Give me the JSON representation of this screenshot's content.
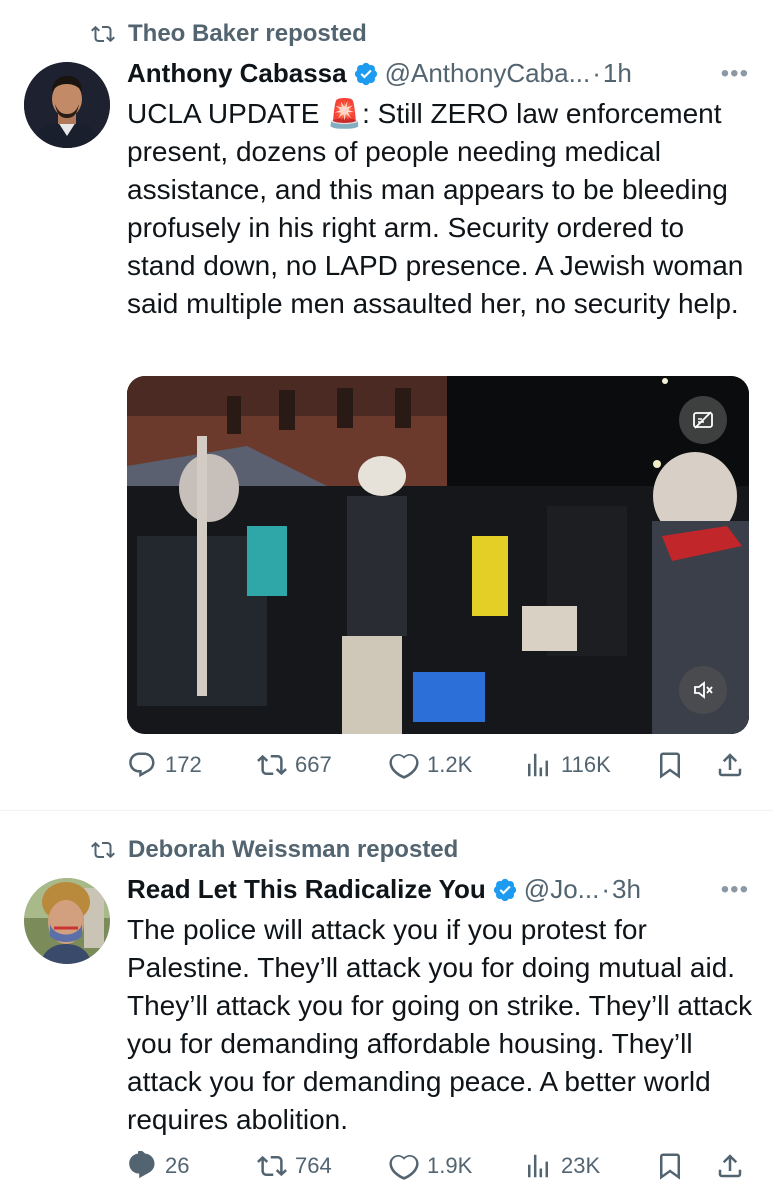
{
  "tweets": [
    {
      "reposted_by": "Theo Baker reposted",
      "name": "Anthony Cabassa",
      "handle": "@AnthonyCaba...",
      "dot": "·",
      "time": "1h",
      "more": "•••",
      "text_prefix": "UCLA UPDATE ",
      "emoji": "🚨",
      "text": ": Still ZERO law enforcement present, dozens of people needing medical assistance, and this man appears to be bleeding profusely in his right arm. Security ordered to stand down, no LAPD presence. A Jewish woman said multiple men assaulted her, no security help.",
      "has_media": true,
      "media_buttons": [
        "captions-icon",
        "mute-icon"
      ],
      "stats": {
        "replies": "172",
        "reposts": "667",
        "likes": "1.2K",
        "views": "116K"
      }
    },
    {
      "reposted_by": "Deborah Weissman reposted",
      "name": "Read Let This Radicalize You",
      "handle": "@Jo...",
      "dot": "·",
      "time": "3h",
      "more": "•••",
      "text": "The police will attack you if you protest for Palestine. They’ll attack you for doing mutual aid. They’ll attack you for going on strike. They’ll attack you for demanding affordable housing. They’ll attack you for demanding peace. A better world requires abolition.",
      "has_media": false,
      "stats": {
        "replies": "26",
        "reposts": "764",
        "likes": "1.9K",
        "views": "23K"
      }
    }
  ],
  "colors": {
    "text": "#0f1419",
    "secondary": "#536471",
    "verified": "#1d9bf0",
    "divider": "#eff3f4"
  }
}
